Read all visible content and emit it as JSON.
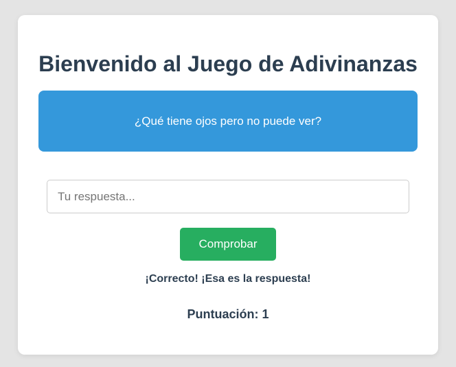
{
  "game": {
    "title": "Bienvenido al Juego de Adivinanzas",
    "riddle": "¿Qué tiene ojos pero no puede ver?",
    "answer_placeholder": "Tu respuesta...",
    "answer_value": "",
    "check_label": "Comprobar",
    "feedback": "¡Correcto! ¡Esa es la respuesta!",
    "score_text": "Puntuación: 1"
  },
  "colors": {
    "background": "#e4e4e4",
    "card": "#ffffff",
    "riddle_box": "#3498db",
    "button": "#27ae60",
    "text_dark": "#2c3e50"
  }
}
